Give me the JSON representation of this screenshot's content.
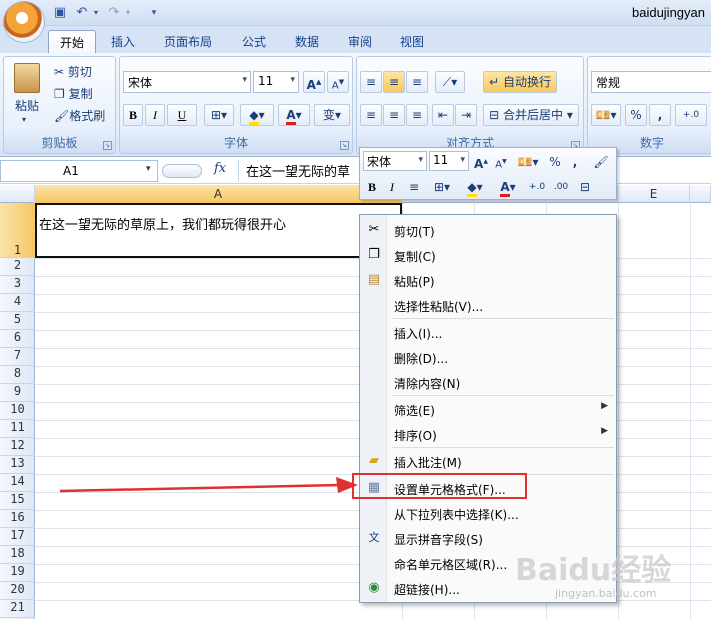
{
  "window": {
    "title": "baidujingyan"
  },
  "qat": {
    "save_icon": "save-icon",
    "undo_icon": "undo-icon",
    "redo_icon": "redo-icon"
  },
  "tabs": [
    {
      "label": "开始",
      "active": true
    },
    {
      "label": "插入"
    },
    {
      "label": "页面布局"
    },
    {
      "label": "公式"
    },
    {
      "label": "数据"
    },
    {
      "label": "审阅"
    },
    {
      "label": "视图"
    }
  ],
  "ribbon": {
    "clipboard": {
      "group_label": "剪贴板",
      "paste": "粘贴",
      "cut": "剪切",
      "copy": "复制",
      "format_painter": "格式刷"
    },
    "font": {
      "group_label": "字体",
      "font_name": "宋体",
      "font_size": "11",
      "bold": "B",
      "italic": "I",
      "underline": "U",
      "font_color": "A",
      "phonetic": "变",
      "grow": "A",
      "shrink": "A"
    },
    "alignment": {
      "group_label": "对齐方式",
      "wrap_text": "自动换行",
      "merge_center": "合并后居中"
    },
    "number": {
      "group_label": "数字",
      "format": "常规",
      "percent": "%",
      "comma": ","
    }
  },
  "formula_bar": {
    "name_box": "A1",
    "fx": "fx",
    "value": "在这一望无际的草"
  },
  "sheet": {
    "columns": [
      "A",
      "E"
    ],
    "rows": [
      "1",
      "2",
      "3",
      "4",
      "5",
      "6",
      "7",
      "8",
      "9",
      "10",
      "11",
      "12",
      "13",
      "14",
      "15",
      "16",
      "17",
      "18",
      "19",
      "20",
      "21"
    ],
    "cell_a1": "在这一望无际的草原上，我们都玩得很开心"
  },
  "mini_toolbar": {
    "font_name": "宋体",
    "font_size": "11",
    "bold": "B",
    "italic": "I",
    "font_color": "A",
    "percent": "%",
    "comma": ","
  },
  "context_menu": {
    "items": [
      {
        "label": "剪切(T)",
        "icon": "scissors-icon"
      },
      {
        "label": "复制(C)",
        "icon": "copy-icon"
      },
      {
        "label": "粘贴(P)",
        "icon": "paste-icon"
      },
      {
        "label": "选择性粘贴(V)...",
        "icon": ""
      },
      {
        "label": "插入(I)...",
        "icon": ""
      },
      {
        "label": "删除(D)...",
        "icon": ""
      },
      {
        "label": "清除内容(N)",
        "icon": ""
      },
      {
        "label": "筛选(E)",
        "icon": "",
        "submenu": true
      },
      {
        "label": "排序(O)",
        "icon": "",
        "submenu": true
      },
      {
        "label": "插入批注(M)",
        "icon": "comment-icon"
      },
      {
        "label": "设置单元格格式(F)...",
        "icon": "format-cells-icon",
        "highlighted": true
      },
      {
        "label": "从下拉列表中选择(K)...",
        "icon": ""
      },
      {
        "label": "显示拼音字段(S)",
        "icon": "phonetic-icon"
      },
      {
        "label": "命名单元格区域(R)...",
        "icon": ""
      },
      {
        "label": "超链接(H)...",
        "icon": "hyperlink-icon"
      }
    ]
  },
  "annotation": {
    "color": "#e03030"
  },
  "watermark": {
    "text": "Baidu经验",
    "url": "jingyan.baidu.com"
  }
}
